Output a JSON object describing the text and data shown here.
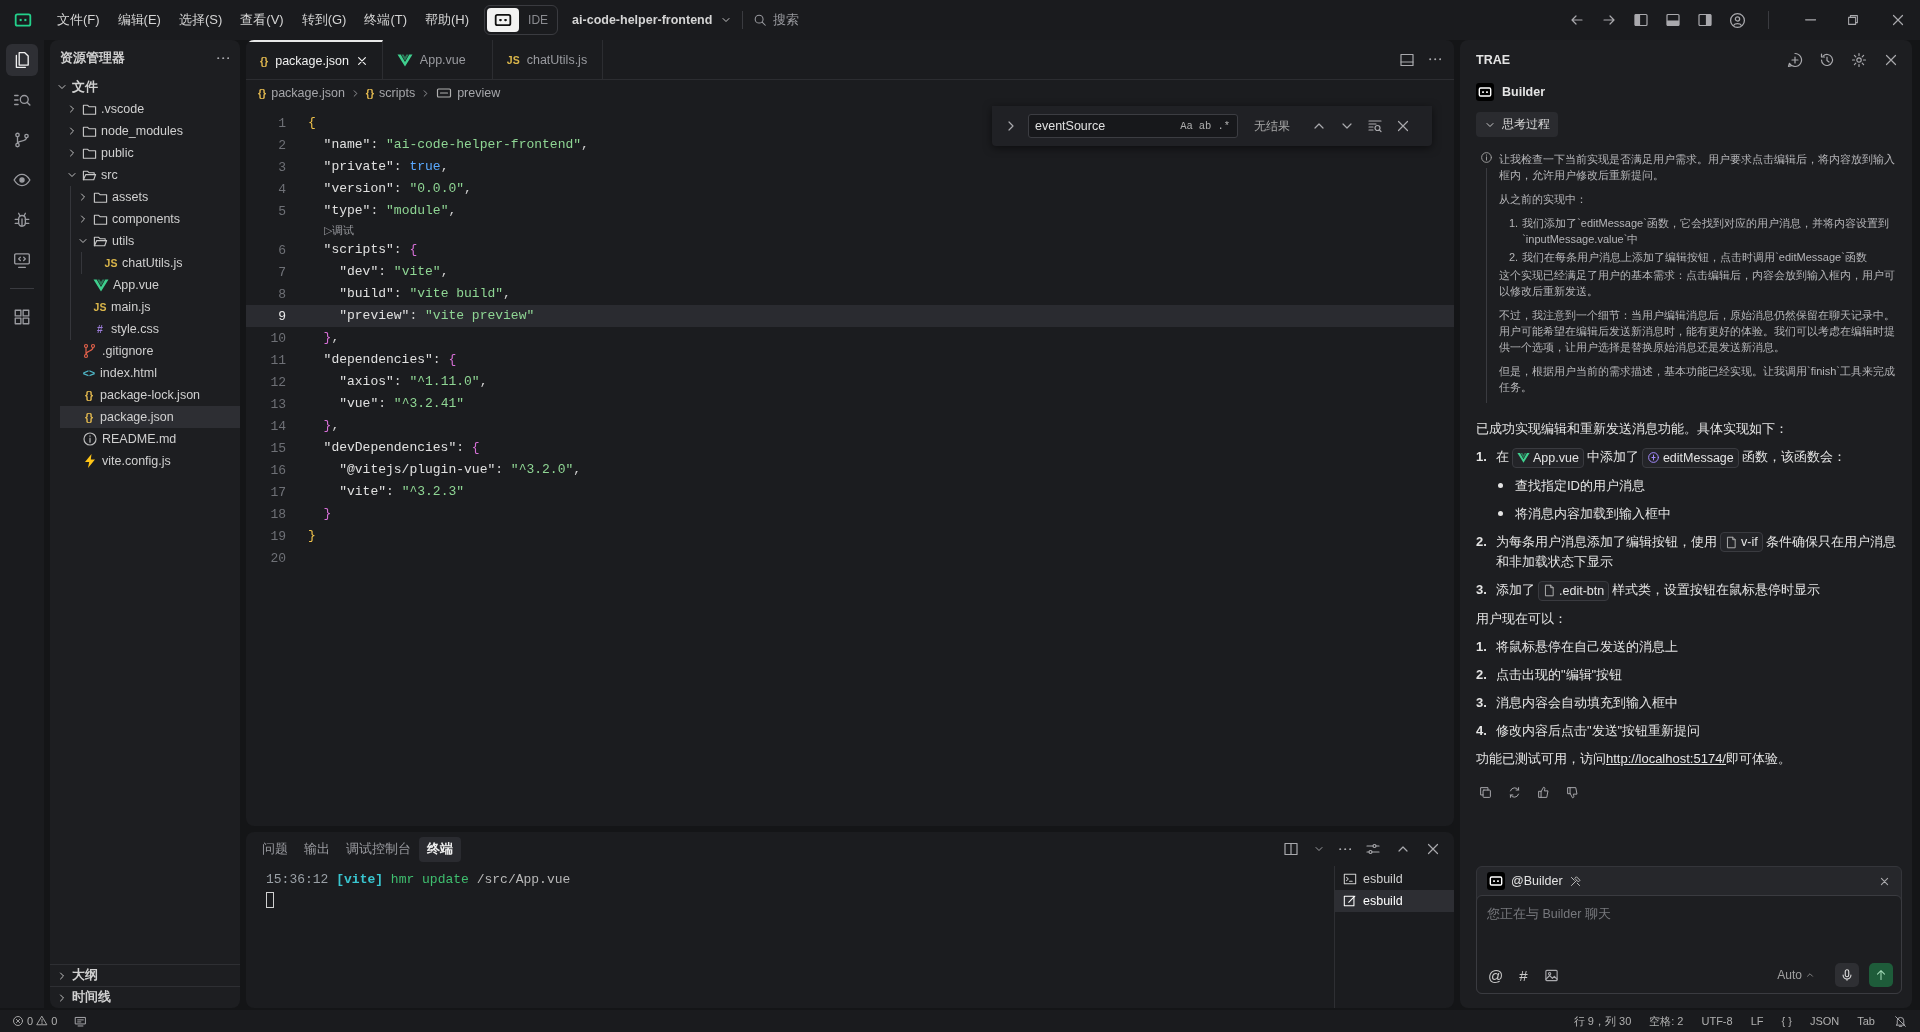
{
  "title_bar": {
    "menus": [
      "文件(F)",
      "编辑(E)",
      "选择(S)",
      "查看(V)",
      "转到(G)",
      "终端(T)",
      "帮助(H)"
    ],
    "modes": [
      {
        "kind": "builder",
        "selected": true
      },
      {
        "kind": "text",
        "label": "IDE",
        "selected": false
      }
    ],
    "project": "ai-code-helper-frontend",
    "search": {
      "label": "搜索"
    }
  },
  "activity_bar": [
    {
      "kind": "files",
      "selected": true
    },
    {
      "kind": "search",
      "selected": false
    },
    {
      "kind": "branch",
      "selected": false
    },
    {
      "kind": "eye",
      "selected": false
    },
    {
      "kind": "bug",
      "selected": false
    },
    {
      "kind": "remote",
      "selected": false
    },
    {
      "kind": "extensions",
      "selected": false
    }
  ],
  "sidebar": {
    "title": "资源管理器",
    "tree": {
      "label": "文件",
      "expanded": true,
      "children": [
        {
          "label": ".vscode",
          "kind": "folder",
          "expanded": false,
          "selected": false
        },
        {
          "label": "node_modules",
          "kind": "folder",
          "expanded": false,
          "selected": false
        },
        {
          "label": "public",
          "kind": "folder",
          "expanded": false,
          "selected": false
        },
        {
          "label": "src",
          "kind": "folder",
          "expanded": true,
          "selected": false,
          "children": [
            {
              "label": "assets",
              "kind": "folder",
              "expanded": false,
              "selected": false
            },
            {
              "label": "components",
              "kind": "folder",
              "expanded": false,
              "selected": false
            },
            {
              "label": "utils",
              "kind": "folder",
              "expanded": true,
              "selected": false,
              "children": [
                {
                  "label": "chatUtils.js",
                  "kind": "js",
                  "glyph": "JS",
                  "selected": false
                }
              ]
            },
            {
              "label": "App.vue",
              "kind": "vue",
              "selected": false
            },
            {
              "label": "main.js",
              "kind": "js",
              "glyph": "JS",
              "selected": false
            },
            {
              "label": "style.css",
              "kind": "css",
              "glyph": "#",
              "selected": false
            }
          ]
        },
        {
          "label": ".gitignore",
          "kind": "git",
          "selected": false
        },
        {
          "label": "index.html",
          "kind": "html",
          "glyph": "<>",
          "selected": false
        },
        {
          "label": "package-lock.json",
          "kind": "json",
          "glyph": "{}",
          "selected": false
        },
        {
          "label": "package.json",
          "kind": "json",
          "glyph": "{}",
          "selected": true
        },
        {
          "label": "README.md",
          "kind": "info",
          "selected": false
        },
        {
          "label": "vite.config.js",
          "kind": "vite",
          "selected": false
        }
      ]
    },
    "sections": [
      {
        "label": "大纲",
        "expanded": false
      },
      {
        "label": "时间线",
        "expanded": false
      }
    ]
  },
  "editor": {
    "tabs": [
      {
        "label": "package.json",
        "kind": "json",
        "glyph": "{}",
        "selected": true
      },
      {
        "label": "App.vue",
        "kind": "vue",
        "selected": false
      },
      {
        "label": "chatUtils.js",
        "kind": "js",
        "glyph": "JS",
        "selected": false
      }
    ],
    "breadcrumbs": [
      {
        "label": "package.json",
        "kind": "json",
        "glyph": "{}"
      },
      {
        "label": "scripts",
        "kind": "json",
        "glyph": "{}"
      },
      {
        "label": "preview",
        "kind": "property"
      }
    ],
    "find": {
      "value": "eventSource",
      "options": [
        "Aa",
        "ab",
        ".*"
      ],
      "result": "无结果"
    },
    "lines": [
      {
        "kind": "code",
        "number": "1",
        "current": false,
        "tokens": [
          {
            "kind": "brace",
            "text": "{"
          }
        ]
      },
      {
        "kind": "code",
        "number": "2",
        "current": false,
        "tokens": [
          {
            "kind": "key",
            "text": "  \"name\""
          },
          {
            "kind": "punct",
            "text": ": "
          },
          {
            "kind": "string",
            "text": "\"ai-code-helper-frontend\""
          },
          {
            "kind": "punct",
            "text": ","
          }
        ]
      },
      {
        "kind": "code",
        "number": "3",
        "current": false,
        "tokens": [
          {
            "kind": "key",
            "text": "  \"private\""
          },
          {
            "kind": "punct",
            "text": ": "
          },
          {
            "kind": "bool",
            "text": "true"
          },
          {
            "kind": "punct",
            "text": ","
          }
        ]
      },
      {
        "kind": "code",
        "number": "4",
        "current": false,
        "tokens": [
          {
            "kind": "key",
            "text": "  \"version\""
          },
          {
            "kind": "punct",
            "text": ": "
          },
          {
            "kind": "string",
            "text": "\"0.0.0\""
          },
          {
            "kind": "punct",
            "text": ","
          }
        ]
      },
      {
        "kind": "code",
        "number": "5",
        "current": false,
        "tokens": [
          {
            "kind": "key",
            "text": "  \"type\""
          },
          {
            "kind": "punct",
            "text": ": "
          },
          {
            "kind": "string",
            "text": "\"module\""
          },
          {
            "kind": "punct",
            "text": ","
          }
        ]
      },
      {
        "kind": "codelens",
        "text": "▷调试"
      },
      {
        "kind": "code",
        "number": "6",
        "current": false,
        "tokens": [
          {
            "kind": "key",
            "text": "  \"scripts\""
          },
          {
            "kind": "punct",
            "text": ": "
          },
          {
            "kind": "brace2",
            "text": "{"
          }
        ]
      },
      {
        "kind": "code",
        "number": "7",
        "current": false,
        "tokens": [
          {
            "kind": "key",
            "text": "    \"dev\""
          },
          {
            "kind": "punct",
            "text": ": "
          },
          {
            "kind": "string",
            "text": "\"vite\""
          },
          {
            "kind": "punct",
            "text": ","
          }
        ]
      },
      {
        "kind": "code",
        "number": "8",
        "current": false,
        "tokens": [
          {
            "kind": "key",
            "text": "    \"build\""
          },
          {
            "kind": "punct",
            "text": ": "
          },
          {
            "kind": "string",
            "text": "\"vite build\""
          },
          {
            "kind": "punct",
            "text": ","
          }
        ]
      },
      {
        "kind": "code",
        "number": "9",
        "current": true,
        "tokens": [
          {
            "kind": "key",
            "text": "    \"preview\""
          },
          {
            "kind": "punct",
            "text": ": "
          },
          {
            "kind": "string",
            "text": "\"vite preview\""
          }
        ]
      },
      {
        "kind": "code",
        "number": "10",
        "current": false,
        "tokens": [
          {
            "kind": "brace2",
            "text": "  }"
          },
          {
            "kind": "punct",
            "text": ","
          }
        ]
      },
      {
        "kind": "code",
        "number": "11",
        "current": false,
        "tokens": [
          {
            "kind": "key",
            "text": "  \"dependencies\""
          },
          {
            "kind": "punct",
            "text": ": "
          },
          {
            "kind": "brace2",
            "text": "{"
          }
        ]
      },
      {
        "kind": "code",
        "number": "12",
        "current": false,
        "tokens": [
          {
            "kind": "key",
            "text": "    \"axios\""
          },
          {
            "kind": "punct",
            "text": ": "
          },
          {
            "kind": "string",
            "text": "\"^1.11.0\""
          },
          {
            "kind": "punct",
            "text": ","
          }
        ]
      },
      {
        "kind": "code",
        "number": "13",
        "current": false,
        "tokens": [
          {
            "kind": "key",
            "text": "    \"vue\""
          },
          {
            "kind": "punct",
            "text": ": "
          },
          {
            "kind": "string",
            "text": "\"^3.2.41\""
          }
        ]
      },
      {
        "kind": "code",
        "number": "14",
        "current": false,
        "tokens": [
          {
            "kind": "brace2",
            "text": "  }"
          },
          {
            "kind": "punct",
            "text": ","
          }
        ]
      },
      {
        "kind": "code",
        "number": "15",
        "current": false,
        "tokens": [
          {
            "kind": "key",
            "text": "  \"devDependencies\""
          },
          {
            "kind": "punct",
            "text": ": "
          },
          {
            "kind": "brace2",
            "text": "{"
          }
        ]
      },
      {
        "kind": "code",
        "number": "16",
        "current": false,
        "tokens": [
          {
            "kind": "key",
            "text": "    \"@vitejs/plugin-vue\""
          },
          {
            "kind": "punct",
            "text": ": "
          },
          {
            "kind": "string",
            "text": "\"^3.2.0\""
          },
          {
            "kind": "punct",
            "text": ","
          }
        ]
      },
      {
        "kind": "code",
        "number": "17",
        "current": false,
        "tokens": [
          {
            "kind": "key",
            "text": "    \"vite\""
          },
          {
            "kind": "punct",
            "text": ": "
          },
          {
            "kind": "string",
            "text": "\"^3.2.3\""
          }
        ]
      },
      {
        "kind": "code",
        "number": "18",
        "current": false,
        "tokens": [
          {
            "kind": "brace2",
            "text": "  }"
          }
        ]
      },
      {
        "kind": "code",
        "number": "19",
        "current": false,
        "tokens": [
          {
            "kind": "brace",
            "text": "}"
          }
        ]
      },
      {
        "kind": "code",
        "number": "20",
        "current": false
      }
    ]
  },
  "panel": {
    "tabs": [
      {
        "label": "问题",
        "selected": false
      },
      {
        "label": "输出",
        "selected": false
      },
      {
        "label": "调试控制台",
        "selected": false
      },
      {
        "label": "终端",
        "selected": true
      }
    ],
    "terminal": [
      {
        "kind": "time",
        "text": "15:36:12"
      },
      {
        "kind": "tag",
        "text": "[vite]"
      },
      {
        "kind": "msg",
        "text": "hmr update"
      },
      {
        "kind": "path",
        "text": "/src/App.vue"
      }
    ],
    "sessions": [
      {
        "label": "esbuild",
        "kind": "terminal",
        "selected": false
      },
      {
        "label": "esbuild",
        "kind": "task",
        "selected": true
      }
    ]
  },
  "chat": {
    "title": "TRAE",
    "agent": "Builder",
    "thinking": {
      "label": "思考过程",
      "expanded": true,
      "blocks": [
        {
          "kind": "para",
          "text": "让我检查一下当前实现是否满足用户需求。用户要求点击编辑后，将内容放到输入框内，允许用户修改后重新提问。"
        },
        {
          "kind": "para",
          "text": "从之前的实现中："
        },
        {
          "kind": "item",
          "marker": "1.",
          "text": "我们添加了`editMessage`函数，它会找到对应的用户消息，并将内容设置到`inputMessage.value`中"
        },
        {
          "kind": "item",
          "marker": "2.",
          "text": "我们在每条用户消息上添加了编辑按钮，点击时调用`editMessage`函数"
        },
        {
          "kind": "para",
          "text": "这个实现已经满足了用户的基本需求：点击编辑后，内容会放到输入框内，用户可以修改后重新发送。"
        },
        {
          "kind": "para",
          "text": "不过，我注意到一个细节：当用户编辑消息后，原始消息仍然保留在聊天记录中。用户可能希望在编辑后发送新消息时，能有更好的体验。我们可以考虑在编辑时提供一个选项，让用户选择是替换原始消息还是发送新消息。"
        },
        {
          "kind": "para",
          "text": "但是，根据用户当前的需求描述，基本功能已经实现。让我调用`finish`工具来完成任务。"
        }
      ]
    },
    "answer": [
      {
        "kind": "para",
        "parts": [
          {
            "text": "已成功实现编辑和重新发送消息功能。具体实现如下："
          }
        ]
      },
      {
        "kind": "item",
        "marker": "1.",
        "parts": [
          {
            "text": "在"
          },
          {
            "chip": "App.vue",
            "kind": "vue"
          },
          {
            "text": "中添加了"
          },
          {
            "chip": "editMessage",
            "kind": "function"
          },
          {
            "text": "函数，该函数会："
          }
        ],
        "bullets": [
          "查找指定ID的用户消息",
          "将消息内容加载到输入框中"
        ]
      },
      {
        "kind": "item",
        "marker": "2.",
        "parts": [
          {
            "text": "为每条用户消息添加了编辑按钮，使用"
          },
          {
            "chip": "v-if",
            "kind": "file"
          },
          {
            "text": "条件确保只在用户消息和非加载状态下显示"
          }
        ]
      },
      {
        "kind": "item",
        "marker": "3.",
        "parts": [
          {
            "text": "添加了"
          },
          {
            "chip": ".edit-btn",
            "kind": "file"
          },
          {
            "text": "样式类，设置按钮在鼠标悬停时显示"
          }
        ]
      },
      {
        "kind": "para",
        "parts": [
          {
            "text": "用户现在可以："
          }
        ]
      },
      {
        "kind": "item",
        "marker": "1.",
        "parts": [
          {
            "text": "将鼠标悬停在自己发送的消息上"
          }
        ]
      },
      {
        "kind": "item",
        "marker": "2.",
        "parts": [
          {
            "text": "点击出现的\"编辑\"按钮"
          }
        ]
      },
      {
        "kind": "item",
        "marker": "3.",
        "parts": [
          {
            "text": "消息内容会自动填充到输入框中"
          }
        ]
      },
      {
        "kind": "item",
        "marker": "4.",
        "parts": [
          {
            "text": "修改内容后点击\"发送\"按钮重新提问"
          }
        ]
      },
      {
        "kind": "para",
        "parts": [
          {
            "text": "功能已测试可用，访问"
          },
          {
            "link": "http://localhost:5174/"
          },
          {
            "text": "即可体验。"
          }
        ]
      }
    ],
    "input": {
      "mention": "@Builder",
      "placeholder": "您正在与 Builder 聊天",
      "tools": [
        {
          "kind": "mention",
          "glyph": "@"
        },
        {
          "kind": "context",
          "glyph": "#"
        },
        {
          "kind": "image"
        }
      ],
      "mode": "Auto"
    }
  },
  "status_bar": {
    "problems": [
      {
        "kind": "error",
        "count": "0"
      },
      {
        "kind": "warning",
        "count": "0"
      }
    ],
    "items": [
      "行 9，列 30",
      "空格: 2",
      "UTF-8",
      "LF",
      "{ }",
      "JSON",
      "Tab"
    ]
  }
}
